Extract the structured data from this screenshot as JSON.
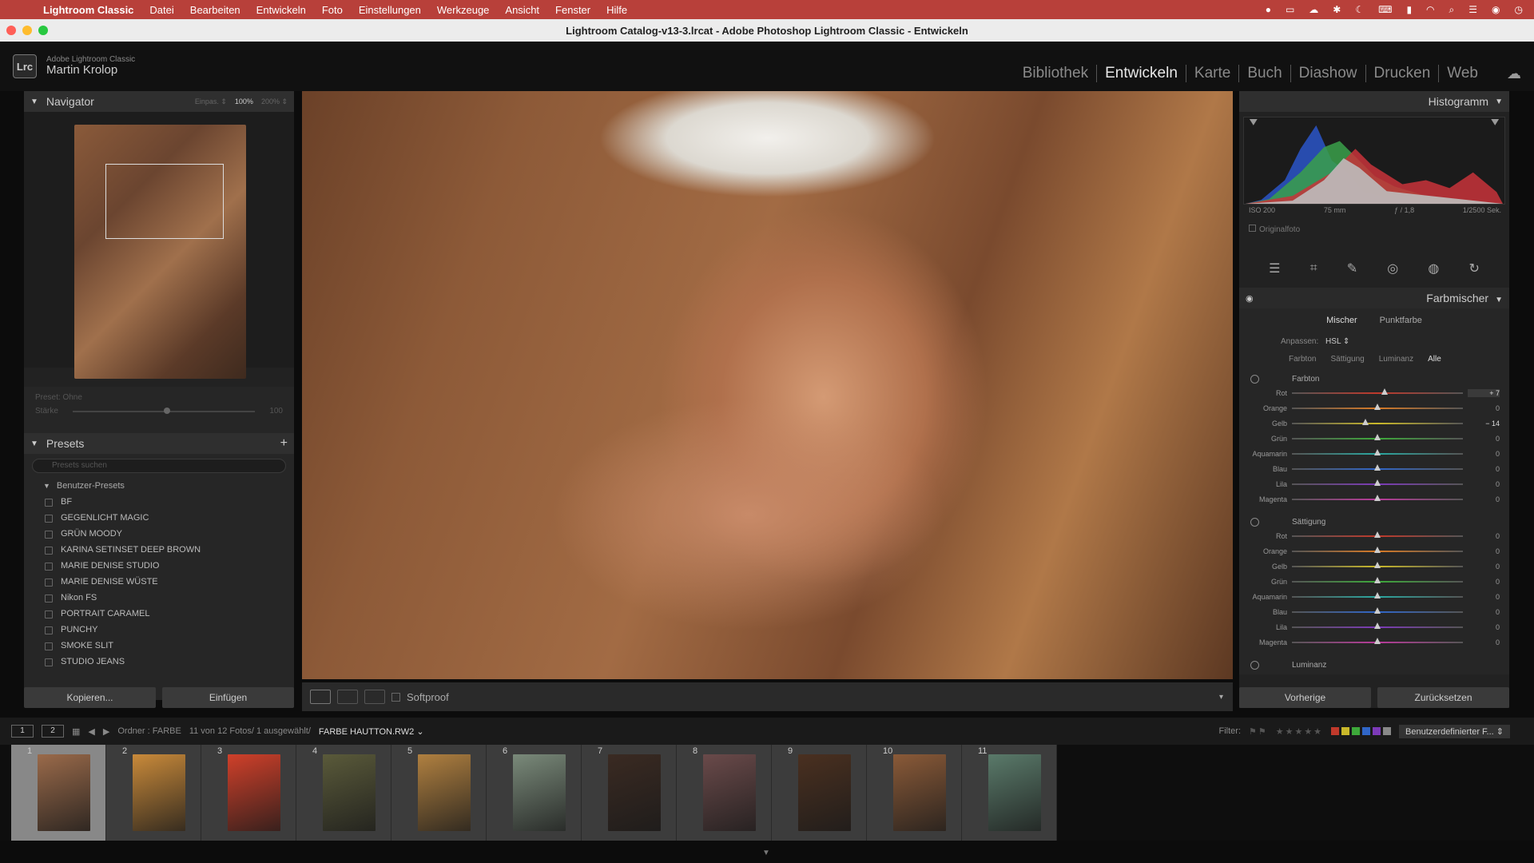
{
  "menubar": {
    "app": "Lightroom Classic",
    "items": [
      "Datei",
      "Bearbeiten",
      "Entwickeln",
      "Foto",
      "Einstellungen",
      "Werkzeuge",
      "Ansicht",
      "Fenster",
      "Hilfe"
    ]
  },
  "window": {
    "title": "Lightroom Catalog-v13-3.lrcat - Adobe Photoshop Lightroom Classic - Entwickeln"
  },
  "identity": {
    "product": "Adobe Lightroom Classic",
    "user": "Martin Krolop",
    "logo": "Lrc"
  },
  "modules": [
    {
      "label": "Bibliothek",
      "active": false
    },
    {
      "label": "Entwickeln",
      "active": true
    },
    {
      "label": "Karte",
      "active": false
    },
    {
      "label": "Buch",
      "active": false
    },
    {
      "label": "Diashow",
      "active": false
    },
    {
      "label": "Drucken",
      "active": false
    },
    {
      "label": "Web",
      "active": false
    }
  ],
  "navigator": {
    "title": "Navigator",
    "zoom": [
      "Einpas. ⇕",
      "100%",
      "200% ⇕"
    ]
  },
  "preset_strength": {
    "label": "Preset: Ohne",
    "strength": "Stärke",
    "value": "100"
  },
  "presets": {
    "title": "Presets",
    "search_placeholder": "Presets suchen",
    "group": "Benutzer-Presets",
    "items": [
      "BF",
      "GEGENLICHT MAGIC",
      "GRÜN MOODY",
      "KARINA SETINSET DEEP BROWN",
      "MARIE DENISE STUDIO",
      "MARIE DENISE WÜSTE",
      "Nikon FS",
      "PORTRAIT CARAMEL",
      "PUNCHY",
      "SMOKE SLIT",
      "STUDIO JEANS"
    ]
  },
  "left_buttons": {
    "copy": "Kopieren...",
    "paste": "Einfügen"
  },
  "toolbar": {
    "softproof": "Softproof"
  },
  "histogram": {
    "title": "Histogramm",
    "iso": "ISO 200",
    "focal": "75 mm",
    "aperture": "ƒ / 1,8",
    "shutter": "1/2500 Sek.",
    "original": "Originalfoto"
  },
  "colormixer": {
    "title": "Farbmischer",
    "tabs": [
      "Mischer",
      "Punktfarbe"
    ],
    "adjust_label": "Anpassen:",
    "adjust_value": "HSL ⇕",
    "subtabs": [
      "Farbton",
      "Sättigung",
      "Luminanz",
      "Alle"
    ],
    "sections": [
      {
        "name": "Farbton",
        "rows": [
          {
            "label": "Rot",
            "value": "+ 7",
            "pos": 0.54,
            "color": "#c0392b"
          },
          {
            "label": "Orange",
            "value": "0",
            "pos": 0.5,
            "color": "#d77a26"
          },
          {
            "label": "Gelb",
            "value": "− 14",
            "pos": 0.43,
            "color": "#c9b82a"
          },
          {
            "label": "Grün",
            "value": "0",
            "pos": 0.5,
            "color": "#3da83a"
          },
          {
            "label": "Aquamarin",
            "value": "0",
            "pos": 0.5,
            "color": "#2aa7a0"
          },
          {
            "label": "Blau",
            "value": "0",
            "pos": 0.5,
            "color": "#3066c8"
          },
          {
            "label": "Lila",
            "value": "0",
            "pos": 0.5,
            "color": "#7c3ab8"
          },
          {
            "label": "Magenta",
            "value": "0",
            "pos": 0.5,
            "color": "#b83a9a"
          }
        ]
      },
      {
        "name": "Sättigung",
        "rows": [
          {
            "label": "Rot",
            "value": "0",
            "pos": 0.5,
            "color": "#c0392b"
          },
          {
            "label": "Orange",
            "value": "0",
            "pos": 0.5,
            "color": "#d77a26"
          },
          {
            "label": "Gelb",
            "value": "0",
            "pos": 0.5,
            "color": "#c9b82a"
          },
          {
            "label": "Grün",
            "value": "0",
            "pos": 0.5,
            "color": "#3da83a"
          },
          {
            "label": "Aquamarin",
            "value": "0",
            "pos": 0.5,
            "color": "#2aa7a0"
          },
          {
            "label": "Blau",
            "value": "0",
            "pos": 0.5,
            "color": "#3066c8"
          },
          {
            "label": "Lila",
            "value": "0",
            "pos": 0.5,
            "color": "#7c3ab8"
          },
          {
            "label": "Magenta",
            "value": "0",
            "pos": 0.5,
            "color": "#b83a9a"
          }
        ]
      }
    ],
    "next_section": "Luminanz"
  },
  "right_buttons": {
    "prev": "Vorherige",
    "reset": "Zurücksetzen"
  },
  "filmbar": {
    "screen1": "1",
    "screen2": "2",
    "source": "Ordner : FARBE",
    "count": "11 von 12 Fotos/ 1 ausgewählt/",
    "file": "FARBE HAUTTON.RW2 ⌄",
    "filter_label": "Filter:",
    "filter_value": "Benutzerdefinierter F... ⇕"
  },
  "filmstrip": [
    {
      "num": "1",
      "sel": true,
      "tone": "#9a6a4a"
    },
    {
      "num": "2",
      "sel": false,
      "tone": "#c98a3a"
    },
    {
      "num": "3",
      "sel": false,
      "tone": "#d0402a"
    },
    {
      "num": "4",
      "sel": false,
      "tone": "#5a5a3a"
    },
    {
      "num": "5",
      "sel": false,
      "tone": "#b08040"
    },
    {
      "num": "6",
      "sel": false,
      "tone": "#7a8a7a"
    },
    {
      "num": "7",
      "sel": false,
      "tone": "#3a2a22"
    },
    {
      "num": "8",
      "sel": false,
      "tone": "#6a4a4a"
    },
    {
      "num": "9",
      "sel": false,
      "tone": "#4a3020"
    },
    {
      "num": "10",
      "sel": false,
      "tone": "#8a5a38"
    },
    {
      "num": "11",
      "sel": false,
      "tone": "#5a7a6a"
    }
  ]
}
